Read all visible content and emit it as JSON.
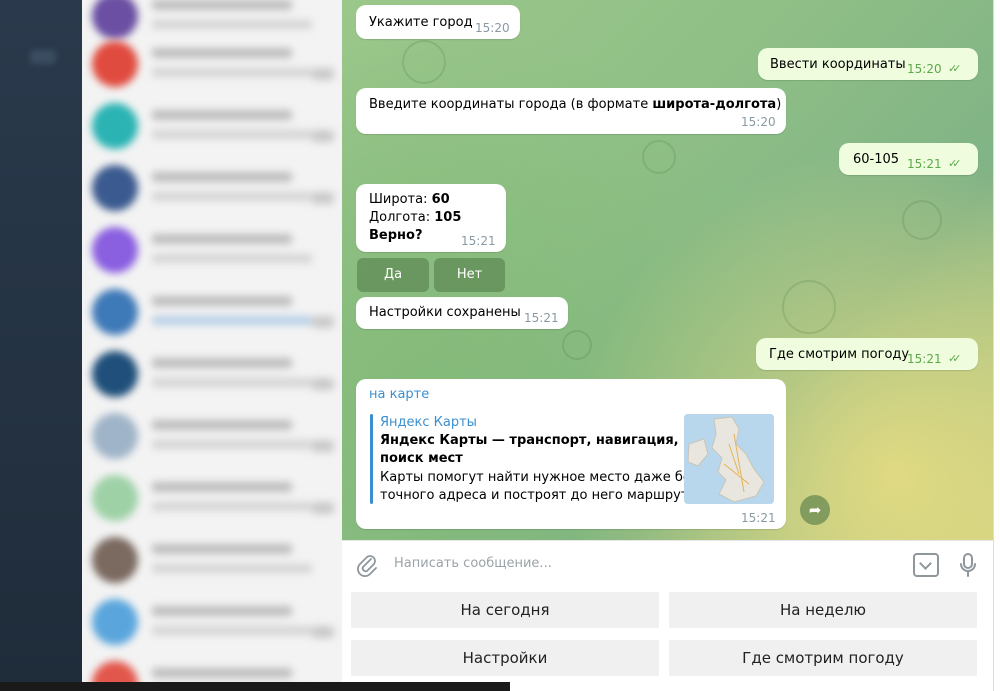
{
  "chat": {
    "messages": [
      {
        "text": "Укажите город",
        "time": "15:20"
      },
      {
        "text": "Ввести координаты",
        "time": "15:20"
      },
      {
        "text_pre": "Введите координаты города (в формате ",
        "text_bold": "широта-долгота",
        "text_post": ")",
        "time": "15:20"
      },
      {
        "text": "60-105",
        "time": "15:21"
      },
      {
        "lat_label": "Широта: ",
        "lat_value": "60",
        "lon_label": "Долгота: ",
        "lon_value": "105",
        "confirm": "Верно?",
        "time": "15:21"
      },
      {
        "text": "Настройки сохранены",
        "time": "15:21"
      },
      {
        "text": "Где смотрим погоду",
        "time": "15:21"
      },
      {
        "link": "на карте",
        "site": "Яндекс Карты",
        "title": "Яндекс Карты — транспорт, навигация, поиск мест",
        "title_line1": "Яндекс Карты — транспорт, навигация,",
        "title_line2": "поиск мест",
        "desc_line1": "Карты помогут найти нужное место даже без",
        "desc_line2": "точного адреса и построят до него маршрут ...",
        "time": "15:21"
      }
    ],
    "inline_buttons": {
      "yes": "Да",
      "no": "Нет"
    },
    "forward_icon": "share-arrow-icon"
  },
  "input": {
    "placeholder": "Написать сообщение...",
    "attach_icon": "paperclip-icon",
    "keyboard_icon": "keyboard-toggle-icon",
    "mic_icon": "microphone-icon"
  },
  "reply_keyboard": {
    "today": "На сегодня",
    "week": "На неделю",
    "settings": "Настройки",
    "where": "Где смотрим погоду"
  },
  "colors": {
    "accent": "#3a8fd0",
    "outgoing_bubble": "#effdde",
    "check": "#5da84a"
  }
}
